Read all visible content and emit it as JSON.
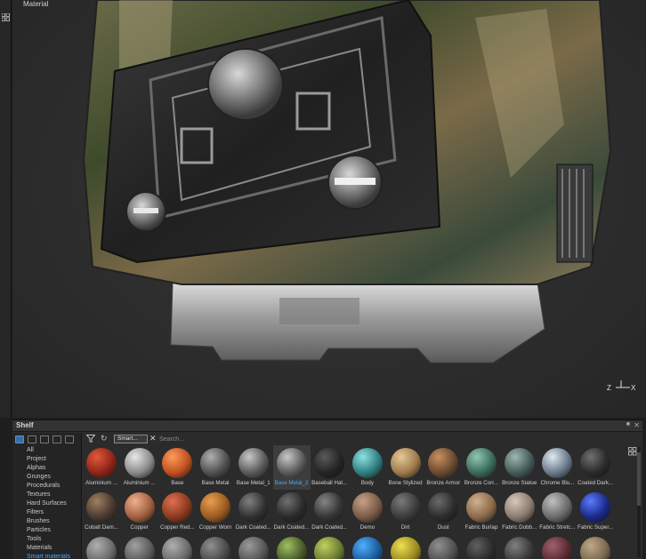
{
  "viewport": {
    "label": "Material",
    "axis_labels": {
      "z": "Z",
      "x": "X"
    }
  },
  "shelf": {
    "title": "Shelf",
    "close_glyph": "✕",
    "dock_glyph": "■",
    "categories": [
      {
        "label": "All",
        "selected": false
      },
      {
        "label": "Project",
        "selected": false
      },
      {
        "label": "Alphas",
        "selected": false
      },
      {
        "label": "Grunges",
        "selected": false
      },
      {
        "label": "Procedurals",
        "selected": false
      },
      {
        "label": "Textures",
        "selected": false
      },
      {
        "label": "Hard Surfaces",
        "selected": false
      },
      {
        "label": "Filters",
        "selected": false
      },
      {
        "label": "Brushes",
        "selected": false
      },
      {
        "label": "Particles",
        "selected": false
      },
      {
        "label": "Tools",
        "selected": false
      },
      {
        "label": "Materials",
        "selected": false
      },
      {
        "label": "Smart materials",
        "selected": true
      }
    ],
    "filter_chip": "Smart...",
    "chip_remove_glyph": "✕",
    "refresh_glyph": "↻",
    "search_placeholder": "Search...",
    "selected_color": "#4aa8ff",
    "rows": [
      [
        {
          "label": "Aluminium ...",
          "color": "#8e2418",
          "highlight": "#e05a3a"
        },
        {
          "label": "Aluminium ...",
          "color": "#8a8a8a",
          "highlight": "#e8e8e8"
        },
        {
          "label": "Base",
          "color": "#c0501f",
          "highlight": "#ff9a5a"
        },
        {
          "label": "Base Metal",
          "color": "#505050",
          "highlight": "#b0b0b0"
        },
        {
          "label": "Base Metal_1",
          "color": "#5a5a5a",
          "highlight": "#c8c8c8"
        },
        {
          "label": "Base Metal_2",
          "color": "#5a5a5a",
          "highlight": "#c8c8c8",
          "selected": true
        },
        {
          "label": "Baseball Hat...",
          "color": "#242424",
          "highlight": "#5a5a5a"
        },
        {
          "label": "Body",
          "color": "#2e7f80",
          "highlight": "#8fe0e0"
        },
        {
          "label": "Bone Stylized",
          "color": "#9c7a4c",
          "highlight": "#e8c896"
        },
        {
          "label": "Bronze Armor",
          "color": "#6a4a30",
          "highlight": "#c89060"
        },
        {
          "label": "Bronze Corr...",
          "color": "#3a6a5a",
          "highlight": "#90c8b0"
        },
        {
          "label": "Bronze Statue",
          "color": "#445a58",
          "highlight": "#a0b8b0"
        },
        {
          "label": "Chrome Blu...",
          "color": "#6a7a8a",
          "highlight": "#e0e8f0"
        },
        {
          "label": "Coated Dark...",
          "color": "#2a2a2a",
          "highlight": "#707070"
        }
      ],
      [
        {
          "label": "Cobalt Dam...",
          "color": "#4a3a30",
          "highlight": "#a08060"
        },
        {
          "label": "Copper",
          "color": "#a06040",
          "highlight": "#f0b090"
        },
        {
          "label": "Copper Red...",
          "color": "#8a3a20",
          "highlight": "#e07050"
        },
        {
          "label": "Copper Worn",
          "color": "#9a5a20",
          "highlight": "#e8a050"
        },
        {
          "label": "Dark Coated...",
          "color": "#303030",
          "highlight": "#808080"
        },
        {
          "label": "Dark Coated...",
          "color": "#2a2a2a",
          "highlight": "#707070"
        },
        {
          "label": "Dark Coated...",
          "color": "#353535",
          "highlight": "#858585"
        },
        {
          "label": "Demo",
          "color": "#7a5a48",
          "highlight": "#c8a088"
        },
        {
          "label": "Dirt",
          "color": "#3a3a3a",
          "highlight": "#7a7a7a"
        },
        {
          "label": "Dust",
          "color": "#2c2c2c",
          "highlight": "#6a6a6a"
        },
        {
          "label": "Fabric Burlap",
          "color": "#8a6a48",
          "highlight": "#d0b090"
        },
        {
          "label": "Fabric Dobb...",
          "color": "#8a7a70",
          "highlight": "#d8c8b8"
        },
        {
          "label": "Fabric Stretc...",
          "color": "#6a6a6a",
          "highlight": "#c0c0c0"
        },
        {
          "label": "Fabric Super...",
          "color": "#1a2a8a",
          "highlight": "#5a7aff"
        }
      ],
      [
        {
          "label": "",
          "color": "#6a6a6a",
          "highlight": "#b0b0b0"
        },
        {
          "label": "",
          "color": "#5a5a5a",
          "highlight": "#a0a0a0"
        },
        {
          "label": "",
          "color": "#6a6a6a",
          "highlight": "#b0b0b0"
        },
        {
          "label": "",
          "color": "#4a4a4a",
          "highlight": "#909090"
        },
        {
          "label": "",
          "color": "#555555",
          "highlight": "#9a9a9a"
        },
        {
          "label": "",
          "color": "#4a5a2a",
          "highlight": "#a0c060"
        },
        {
          "label": "",
          "color": "#6a7a30",
          "highlight": "#c0d060"
        },
        {
          "label": "",
          "color": "#1a5a9a",
          "highlight": "#50b0ff"
        },
        {
          "label": "",
          "color": "#9a8a20",
          "highlight": "#f0e050"
        },
        {
          "label": "",
          "color": "#505050",
          "highlight": "#909090"
        },
        {
          "label": "",
          "color": "#2a2a2a",
          "highlight": "#606060"
        },
        {
          "label": "",
          "color": "#3a3a3a",
          "highlight": "#808080"
        },
        {
          "label": "",
          "color": "#5a2a30",
          "highlight": "#a06070"
        },
        {
          "label": "",
          "color": "#7a6a50",
          "highlight": "#c0a888"
        }
      ]
    ]
  }
}
